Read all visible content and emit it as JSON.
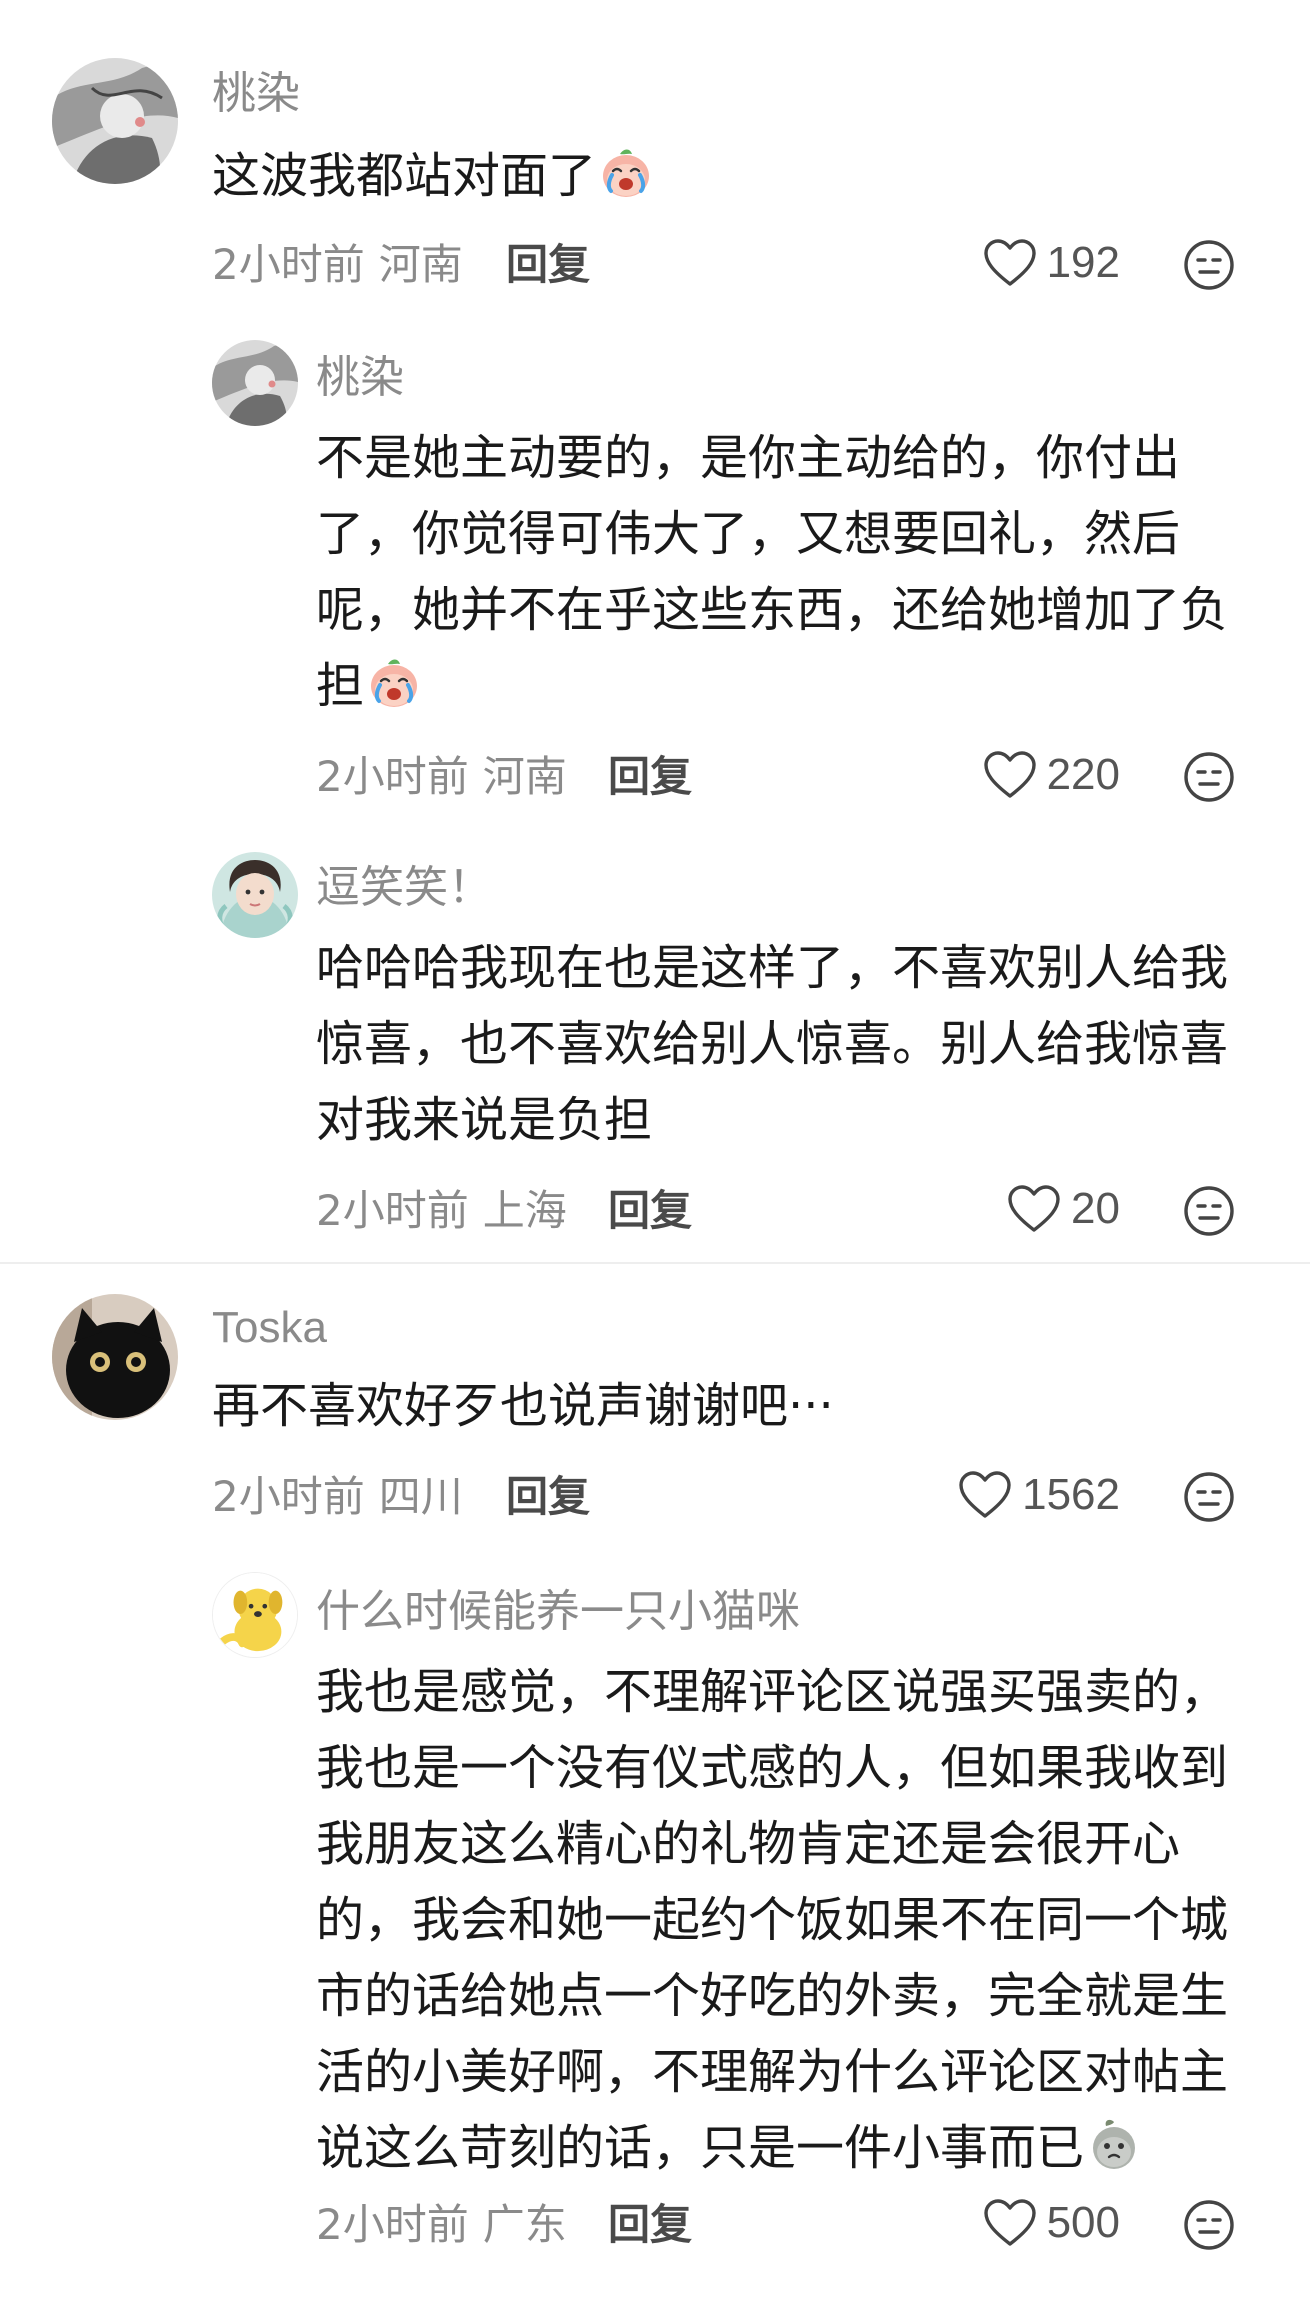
{
  "comments": [
    {
      "username": "桃染",
      "text_lines": [
        "这波我都站对面了"
      ],
      "emoji_icon": "crying-laughing-peach-emoji",
      "time": "2小时前",
      "location": "河南",
      "reply_label": "回复",
      "likes": "192",
      "replies": [
        {
          "username": "桃染",
          "text_lines": [
            "不是她主动要的，是你主动给的，你付出",
            "了，你觉得可伟大了，又想要回礼，然后",
            "呢，她并不在乎这些东西，还给她增加了负",
            "担"
          ],
          "emoji_icon": "crying-laughing-peach-emoji",
          "time": "2小时前",
          "location": "河南",
          "reply_label": "回复",
          "likes": "220"
        },
        {
          "username": "逗笑笑！",
          "text_lines": [
            "哈哈哈我现在也是这样了，不喜欢别人给我",
            "惊喜，也不喜欢给别人惊喜。别人给我惊喜",
            "对我来说是负担"
          ],
          "time": "2小时前",
          "location": "上海",
          "reply_label": "回复",
          "likes": "20"
        }
      ]
    },
    {
      "username": "Toska",
      "text_lines": [
        "再不喜欢好歹也说声谢谢吧···"
      ],
      "time": "2小时前",
      "location": "四川",
      "reply_label": "回复",
      "likes": "1562",
      "replies": [
        {
          "username": "什么时候能养一只小猫咪",
          "text_lines": [
            "我也是感觉，不理解评论区说强买强卖的，",
            "我也是一个没有仪式感的人，但如果我收到",
            "我朋友这么精心的礼物肯定还是会很开心",
            "的，我会和她一起约个饭如果不在同一个城",
            "市的话给她点一个好吃的外卖，完全就是生",
            "活的小美好啊，不理解为什么评论区对帖主",
            "说这么苛刻的话，只是一件小事而已"
          ],
          "emoji_icon": "sad-sprout-emoji",
          "time": "2小时前",
          "location": "广东",
          "reply_label": "回复",
          "likes": "500"
        }
      ]
    }
  ]
}
